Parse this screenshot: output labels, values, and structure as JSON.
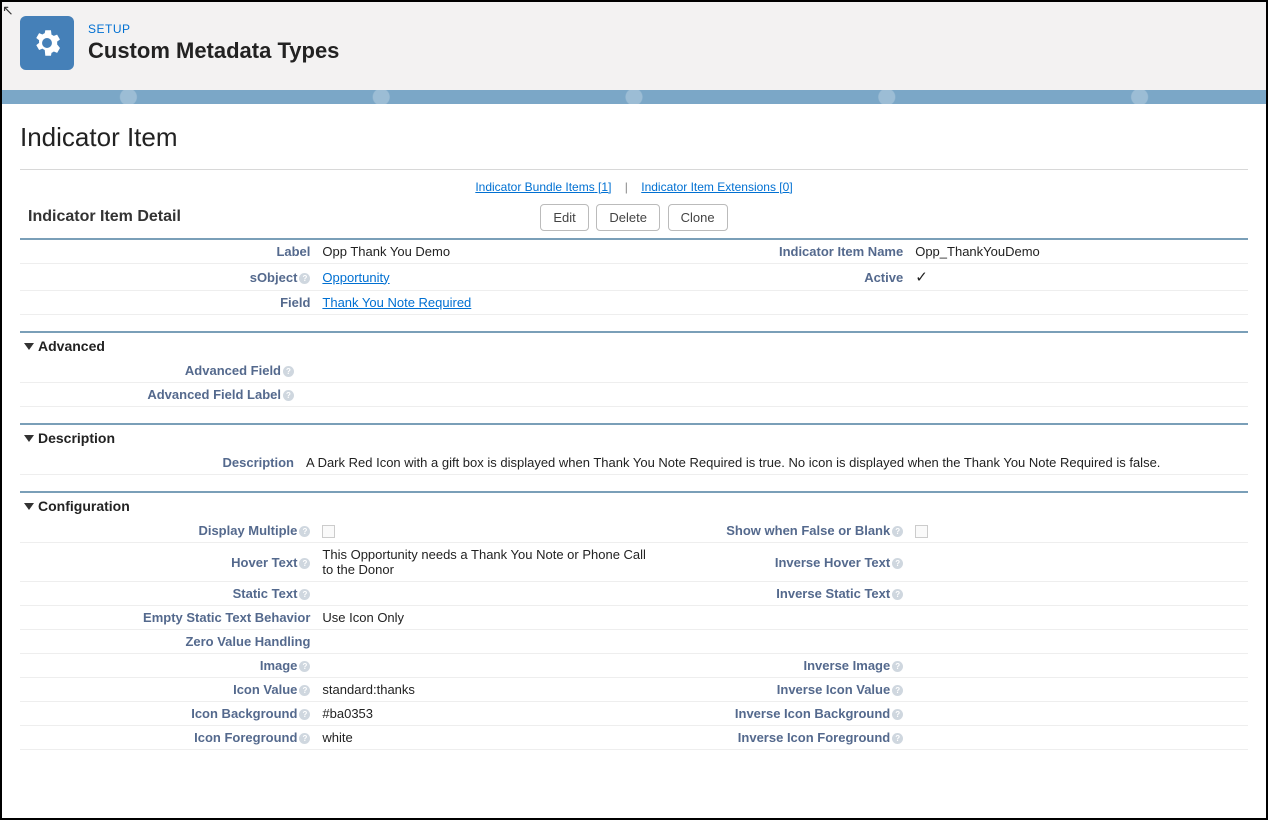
{
  "header": {
    "setup": "SETUP",
    "page_type": "Custom Metadata Types"
  },
  "record": {
    "title": "Indicator Item"
  },
  "related": {
    "bundle_items": {
      "label": "Indicator Bundle Items",
      "count": "1"
    },
    "item_extensions": {
      "label": "Indicator Item Extensions",
      "count": "0"
    },
    "separator": "|"
  },
  "detail": {
    "title": "Indicator Item Detail",
    "buttons": {
      "edit": "Edit",
      "delete": "Delete",
      "clone": "Clone"
    },
    "labels": {
      "label": "Label",
      "sobject": "sObject",
      "field": "Field",
      "indicator_item_name": "Indicator Item Name",
      "active": "Active"
    },
    "values": {
      "label": "Opp Thank You Demo",
      "sobject": "Opportunity",
      "field": "Thank You Note Required",
      "indicator_item_name": "Opp_ThankYouDemo"
    }
  },
  "sections": {
    "advanced": {
      "title": "Advanced",
      "labels": {
        "advanced_field": "Advanced Field",
        "advanced_field_label": "Advanced Field Label"
      },
      "values": {
        "advanced_field": "",
        "advanced_field_label": ""
      }
    },
    "description": {
      "title": "Description",
      "labels": {
        "description": "Description"
      },
      "values": {
        "description": "A Dark Red Icon with a gift box is displayed when Thank You Note Required is true. No icon is displayed when the Thank You Note Required is false."
      }
    },
    "configuration": {
      "title": "Configuration",
      "labels": {
        "display_multiple": "Display Multiple",
        "show_when_false": "Show when False or Blank",
        "hover_text": "Hover Text",
        "inverse_hover_text": "Inverse Hover Text",
        "static_text": "Static Text",
        "inverse_static_text": "Inverse Static Text",
        "empty_static_behavior": "Empty Static Text Behavior",
        "zero_value_handling": "Zero Value Handling",
        "image": "Image",
        "inverse_image": "Inverse Image",
        "icon_value": "Icon Value",
        "inverse_icon_value": "Inverse Icon Value",
        "icon_background": "Icon Background",
        "inverse_icon_background": "Inverse Icon Background",
        "icon_foreground": "Icon Foreground",
        "inverse_icon_foreground": "Inverse Icon Foreground"
      },
      "values": {
        "hover_text": "This Opportunity needs a Thank You Note or Phone Call to the Donor",
        "static_text": "",
        "empty_static_behavior": "Use Icon Only",
        "zero_value_handling": "",
        "image": "",
        "icon_value": "standard:thanks",
        "icon_background": "#ba0353",
        "icon_foreground": "white",
        "inverse_hover_text": "",
        "inverse_static_text": "",
        "inverse_image": "",
        "inverse_icon_value": "",
        "inverse_icon_background": "",
        "inverse_icon_foreground": ""
      }
    }
  }
}
